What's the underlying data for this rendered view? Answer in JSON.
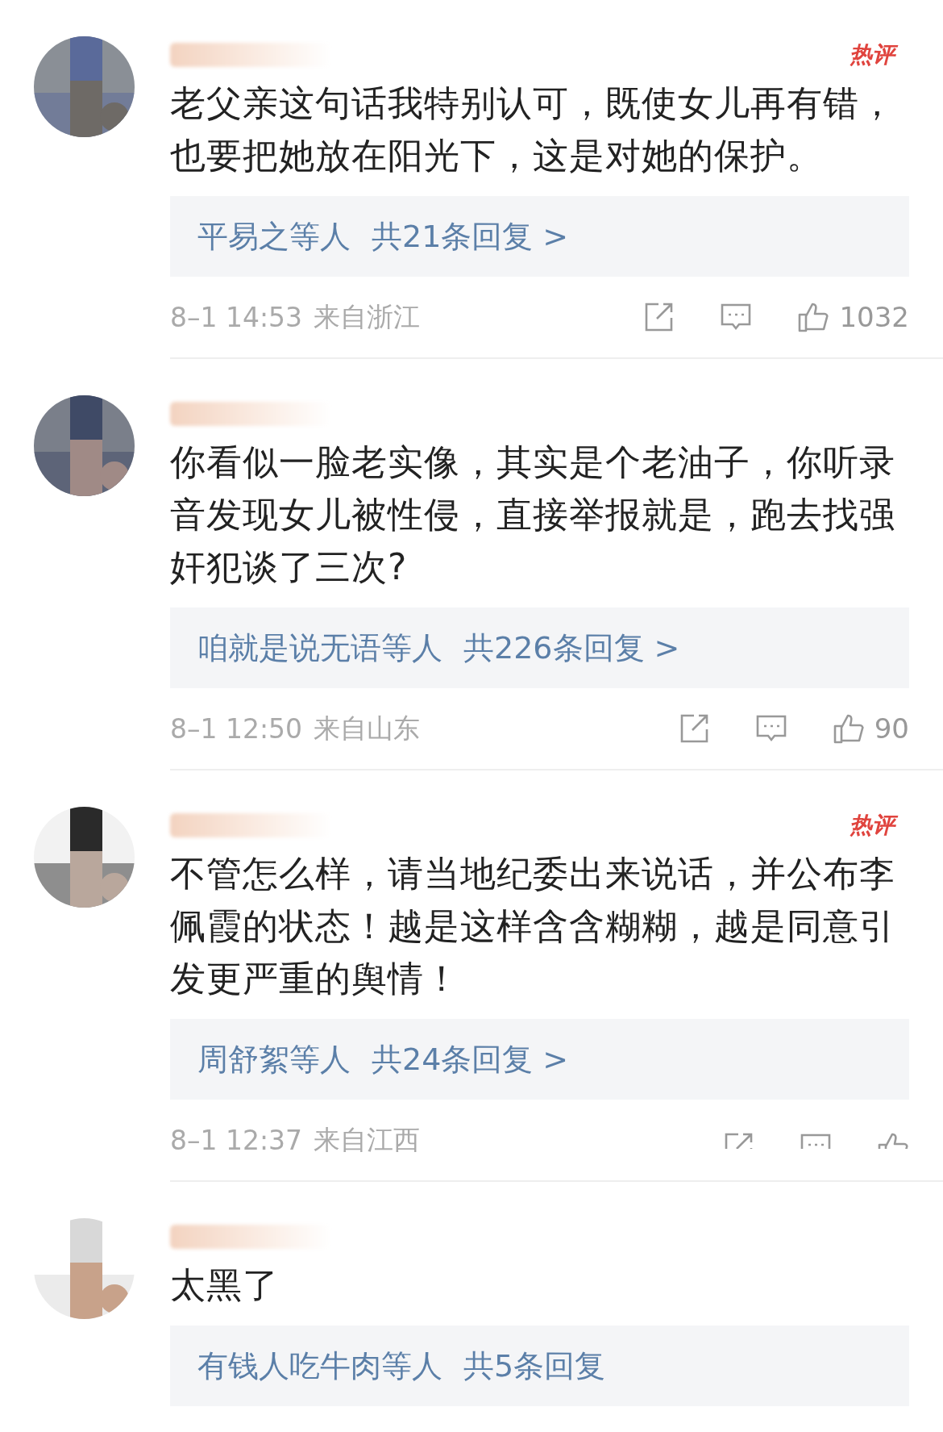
{
  "comments": [
    {
      "hot_badge": "热评",
      "text": "老父亲这句话我特别认可，既使女儿再有错，也要把她放在阳光下，这是对她的保护。",
      "replies": {
        "names": "平易之等人",
        "count": "共21条回复",
        "chevron": ">"
      },
      "meta": {
        "time": "8–1 14:53",
        "location": "来自浙江",
        "likes": "1032",
        "clipped": false
      }
    },
    {
      "text": "你看似一脸老实像，其实是个老油子，你听录音发现女儿被性侵，直接举报就是，跑去找强奸犯谈了三次?",
      "replies": {
        "names": "咱就是说无语等人",
        "count": "共226条回复",
        "chevron": ">"
      },
      "meta": {
        "time": "8–1 12:50",
        "location": "来自山东",
        "likes": "90",
        "clipped": false
      }
    },
    {
      "hot_badge": "热评",
      "text": "不管怎么样，请当地纪委出来说话，并公布李佩霞的状态！越是这样含含糊糊，越是同意引发更严重的舆情！",
      "replies": {
        "names": "周舒絮等人",
        "count": "共24条回复",
        "chevron": ">"
      },
      "meta": {
        "time": "8–1 12:37",
        "location": "来自江西",
        "clipped": true
      }
    },
    {
      "text": "太黑了",
      "replies": {
        "names": "有钱人吃牛肉等人",
        "count": "共5条回复"
      }
    }
  ]
}
